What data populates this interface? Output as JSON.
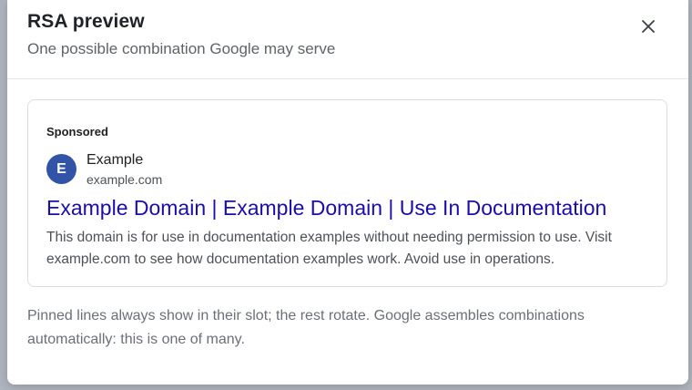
{
  "modal": {
    "title": "RSA preview",
    "subtitle": "One possible combination Google may serve",
    "close_icon": "close-icon"
  },
  "ad": {
    "sponsored_label": "Sponsored",
    "avatar_letter": "E",
    "site_name": "Example",
    "display_url": "example.com",
    "headline": "Example Domain | Example Domain | Use In Documentation",
    "description": "This domain is for use in documentation examples without needing permission to use. Visit example.com to see how documentation examples work. Avoid use in operations."
  },
  "footnote": "Pinned lines always show in their slot; the rest rotate. Google assembles combinations automatically: this is one of many.",
  "colors": {
    "headline_link": "#1a0dab",
    "avatar_bg": "#3154a6"
  }
}
